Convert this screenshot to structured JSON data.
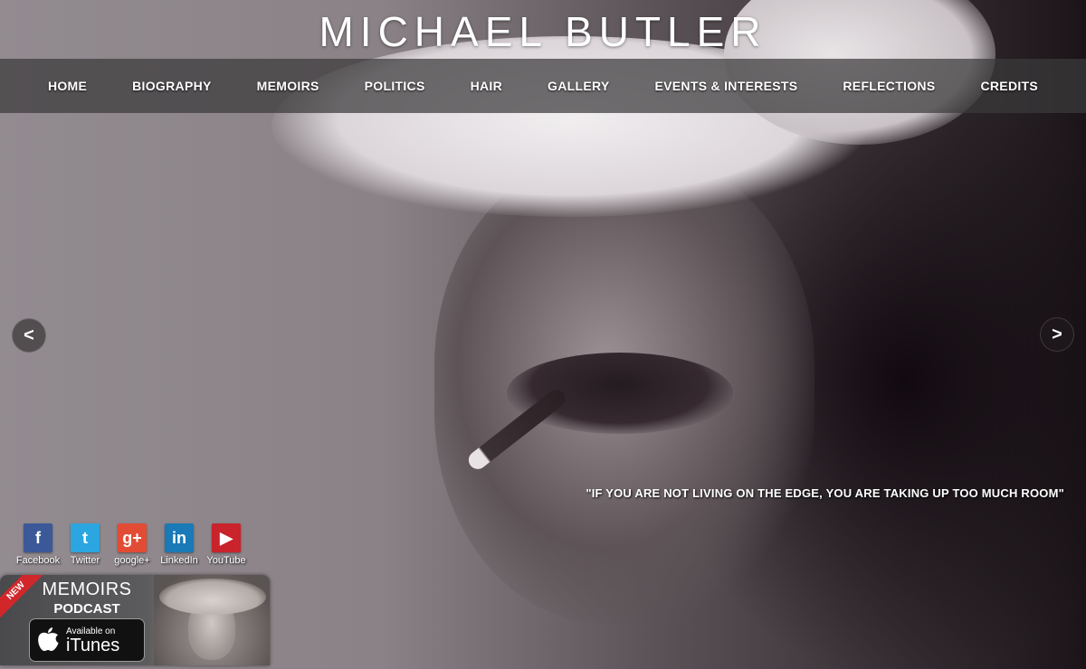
{
  "site": {
    "title": "MICHAEL BUTLER"
  },
  "nav": {
    "items": [
      {
        "label": "HOME"
      },
      {
        "label": "BIOGRAPHY"
      },
      {
        "label": "MEMOIRS"
      },
      {
        "label": "POLITICS"
      },
      {
        "label": "HAIR"
      },
      {
        "label": "GALLERY"
      },
      {
        "label": "EVENTS & INTERESTS"
      },
      {
        "label": "REFLECTIONS"
      },
      {
        "label": "CREDITS"
      }
    ]
  },
  "slider": {
    "prev_label": "<",
    "next_label": ">",
    "quote": "\"IF YOU ARE NOT LIVING ON THE EDGE, YOU ARE TAKING UP TOO MUCH ROOM\""
  },
  "social": {
    "items": [
      {
        "label": "Facebook",
        "icon": "facebook-icon",
        "glyph": "f",
        "color": "#3b5998"
      },
      {
        "label": "Twitter",
        "icon": "twitter-icon",
        "glyph": "t",
        "color": "#2ba6e0"
      },
      {
        "label": "google+",
        "icon": "google-plus-icon",
        "glyph": "g+",
        "color": "#e24c35"
      },
      {
        "label": "LinkedIn",
        "icon": "linkedin-icon",
        "glyph": "in",
        "color": "#1a79b7"
      },
      {
        "label": "YouTube",
        "icon": "youtube-icon",
        "glyph": "▶",
        "color": "#c9232b"
      }
    ]
  },
  "podcast": {
    "badge": "NEW",
    "title": "MEMOIRS",
    "subtitle": "PODCAST",
    "store_small": "Available on",
    "store_big": "iTunes"
  }
}
